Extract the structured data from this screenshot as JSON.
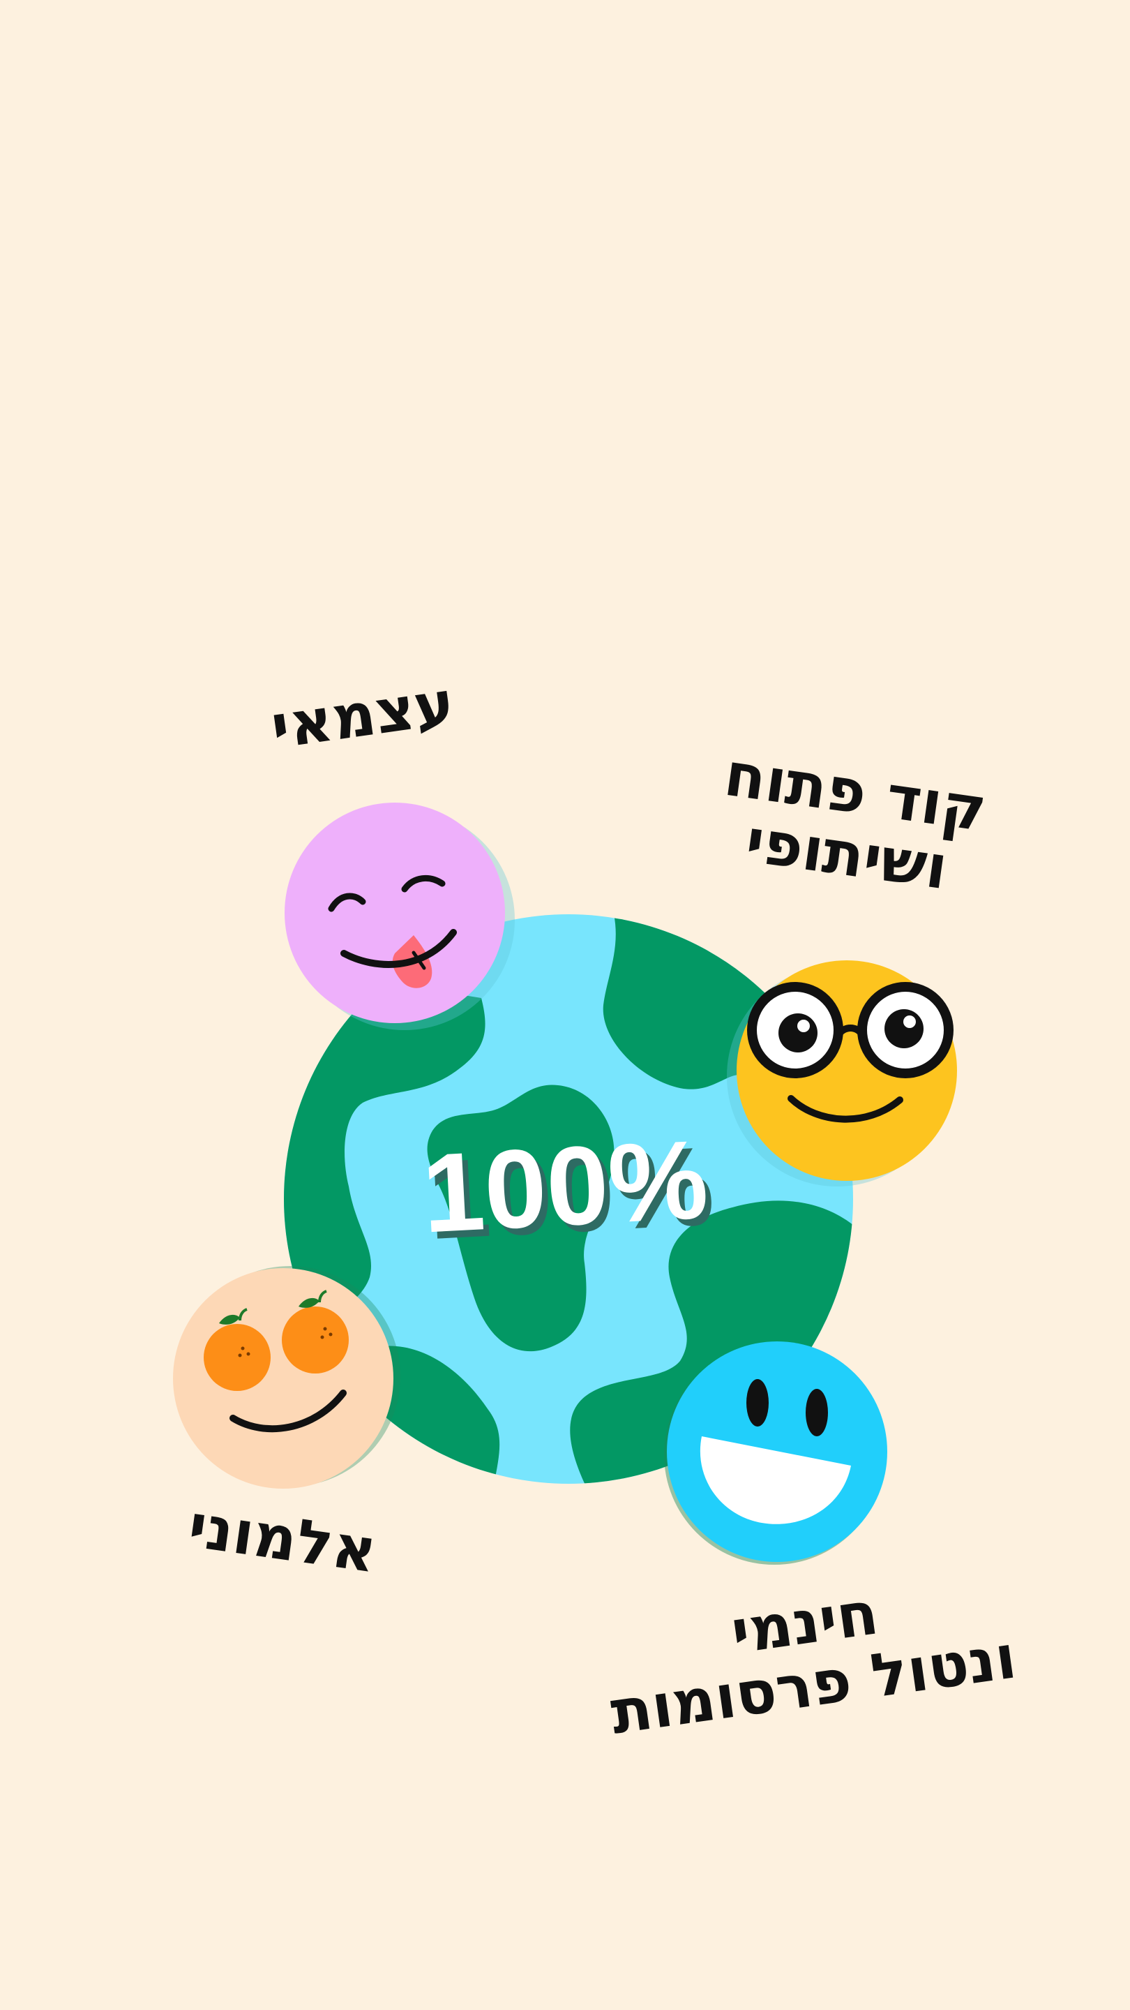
{
  "hero": {
    "percent": "100%"
  },
  "features": {
    "independent": {
      "line1": "עצמאי",
      "face": "tongue-face-icon",
      "color": "#eeb0fb"
    },
    "open_source": {
      "line1": "קוד פתוח",
      "line2": "ושיתופי",
      "face": "glasses-face-icon",
      "color": "#fdc41f"
    },
    "anonymous": {
      "line1": "אלמוני",
      "face": "orange-eyes-face-icon",
      "color": "#fdd8b6"
    },
    "free": {
      "line1": "חינמי",
      "line2": "ונטול פרסומות",
      "face": "laughing-face-icon",
      "color": "#21cffb"
    }
  },
  "colors": {
    "background": "#fdf1df",
    "ocean": "#78e5fd",
    "land": "#039864"
  }
}
